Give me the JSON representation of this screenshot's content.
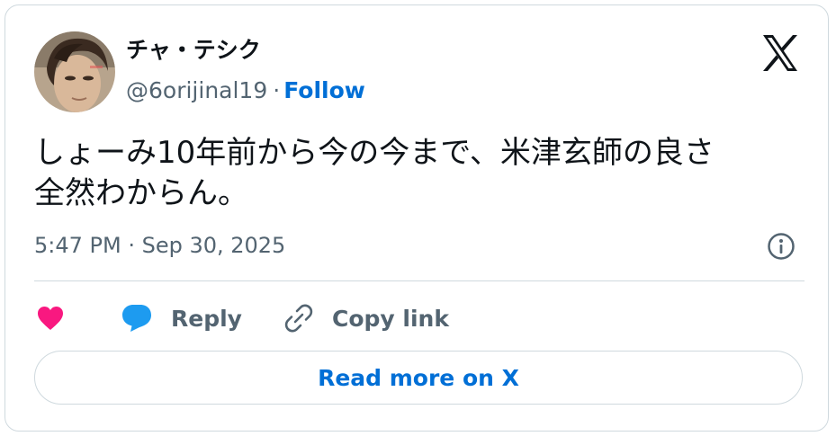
{
  "user": {
    "display_name": "チャ・テシク",
    "handle": "@6orijinal19",
    "separator": "·",
    "follow_label": "Follow"
  },
  "tweet": {
    "text": "しょーみ10年前から今の今まで、米津玄師の良さ\n全然わからん。",
    "timestamp": "5:47 PM · Sep 30, 2025"
  },
  "actions": {
    "like_icon": "heart-icon",
    "reply_label": "Reply",
    "reply_icon": "speech-bubble-icon",
    "copy_label": "Copy link",
    "copy_icon": "link-icon"
  },
  "read_more_label": "Read more on X",
  "colors": {
    "accent": "#006fd6",
    "heart": "#f91880",
    "reply_bubble": "#1d9bf0",
    "muted": "#536471",
    "text": "#0f1419",
    "border": "#cfd9de"
  },
  "icons": {
    "brand": "x-logo-icon",
    "info": "info-icon"
  }
}
